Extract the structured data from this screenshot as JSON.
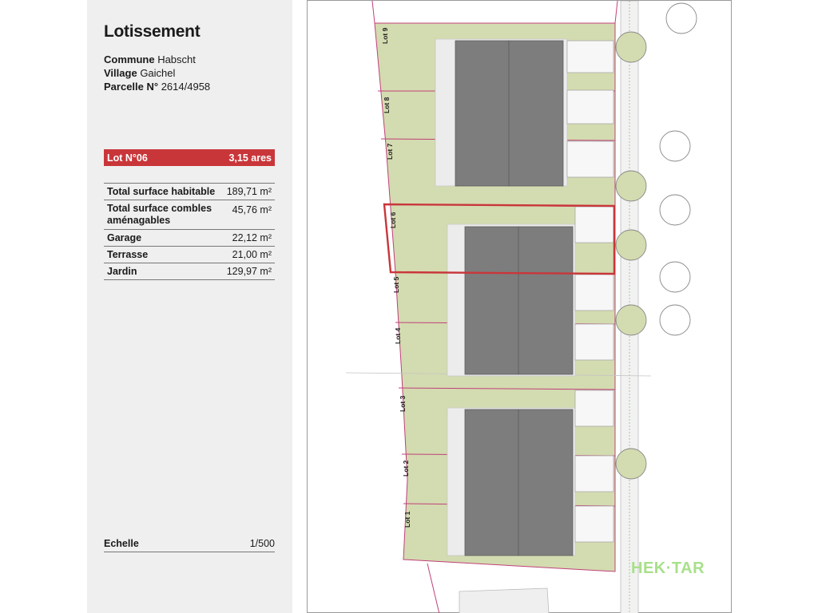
{
  "panel": {
    "title": "Lotissement",
    "commune_label": "Commune",
    "commune_value": "Habscht",
    "village_label": "Village",
    "village_value": "Gaichel",
    "parcelle_label": "Parcelle N°",
    "parcelle_value": "2614/4958",
    "lot_name": "Lot N°06",
    "lot_area": "3,15 ares",
    "rows": [
      {
        "label": "Total surface habitable",
        "value": "189,71 m²"
      },
      {
        "label": "Total surface combles aménagables",
        "value": "45,76 m²"
      },
      {
        "label": "Garage",
        "value": "22,12 m²"
      },
      {
        "label": "Terrasse",
        "value": "21,00 m²"
      },
      {
        "label": "Jardin",
        "value": "129,97 m²"
      }
    ],
    "scale_label": "Echelle",
    "scale_value": "1/500"
  },
  "plan": {
    "lots": [
      "Lot 9",
      "Lot 8",
      "Lot 7",
      "Lot 6",
      "Lot 5",
      "Lot 4",
      "Lot 3",
      "Lot 2",
      "Lot 1"
    ],
    "selected_lot": "Lot 6",
    "brand": "HEK·TAR"
  },
  "colors": {
    "accent": "#c9363a",
    "lawn": "#d3dbb0",
    "roof": "#7d7d7d",
    "boundary": "#c0407a",
    "brand": "#a8e08a"
  }
}
